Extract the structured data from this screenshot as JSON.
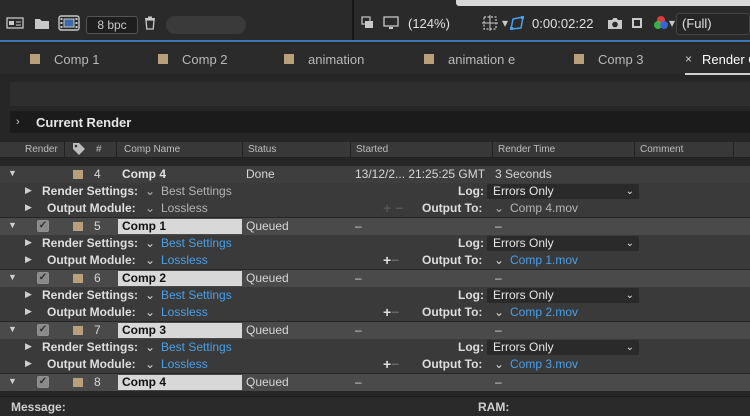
{
  "toolbar": {
    "bit_depth": "8 bpc",
    "zoom": "(124%)",
    "timecode": "0:00:02:22",
    "resolution": "(Full)"
  },
  "tabs": [
    {
      "label": "Comp 1",
      "active": false
    },
    {
      "label": "Comp 2",
      "active": false
    },
    {
      "label": "animation",
      "active": false
    },
    {
      "label": "animation e",
      "active": false
    },
    {
      "label": "Comp 3",
      "active": false
    },
    {
      "label": "Render Q",
      "active": true
    }
  ],
  "tab_close": "×",
  "current_render": {
    "label": "Current Render"
  },
  "queue": {
    "columns": {
      "render": "Render",
      "number": "#",
      "comp_name": "Comp Name",
      "status": "Status",
      "started": "Started",
      "render_time": "Render Time",
      "comment": "Comment"
    },
    "labels": {
      "render_settings": "Render Settings:",
      "output_module": "Output Module:",
      "log": "Log:",
      "output_to": "Output To:"
    },
    "items": [
      {
        "number": "4",
        "comp": "Comp 4",
        "status": "Done",
        "started": "13/12/2... 21:25:25 GMT",
        "render_time": "3 Seconds",
        "render_settings": "Best Settings",
        "output_module": "Lossless",
        "log": "Errors Only",
        "output_to": "Comp 4.mov",
        "checked": false,
        "done": true
      },
      {
        "number": "5",
        "comp": "Comp 1",
        "status": "Queued",
        "started": "–",
        "render_time": "–",
        "render_settings": "Best Settings",
        "output_module": "Lossless",
        "log": "Errors Only",
        "output_to": "Comp 1.mov",
        "checked": true,
        "done": false
      },
      {
        "number": "6",
        "comp": "Comp 2",
        "status": "Queued",
        "started": "–",
        "render_time": "–",
        "render_settings": "Best Settings",
        "output_module": "Lossless",
        "log": "Errors Only",
        "output_to": "Comp 2.mov",
        "checked": true,
        "done": false
      },
      {
        "number": "7",
        "comp": "Comp 3",
        "status": "Queued",
        "started": "–",
        "render_time": "–",
        "render_settings": "Best Settings",
        "output_module": "Lossless",
        "log": "Errors Only",
        "output_to": "Comp 3.mov",
        "checked": true,
        "done": false
      },
      {
        "number": "8",
        "comp": "Comp 4",
        "status": "Queued",
        "started": "–",
        "render_time": "–",
        "checked": true,
        "done": false
      }
    ]
  },
  "status_bar": {
    "message_label": "Message:",
    "ram_label": "RAM:"
  }
}
